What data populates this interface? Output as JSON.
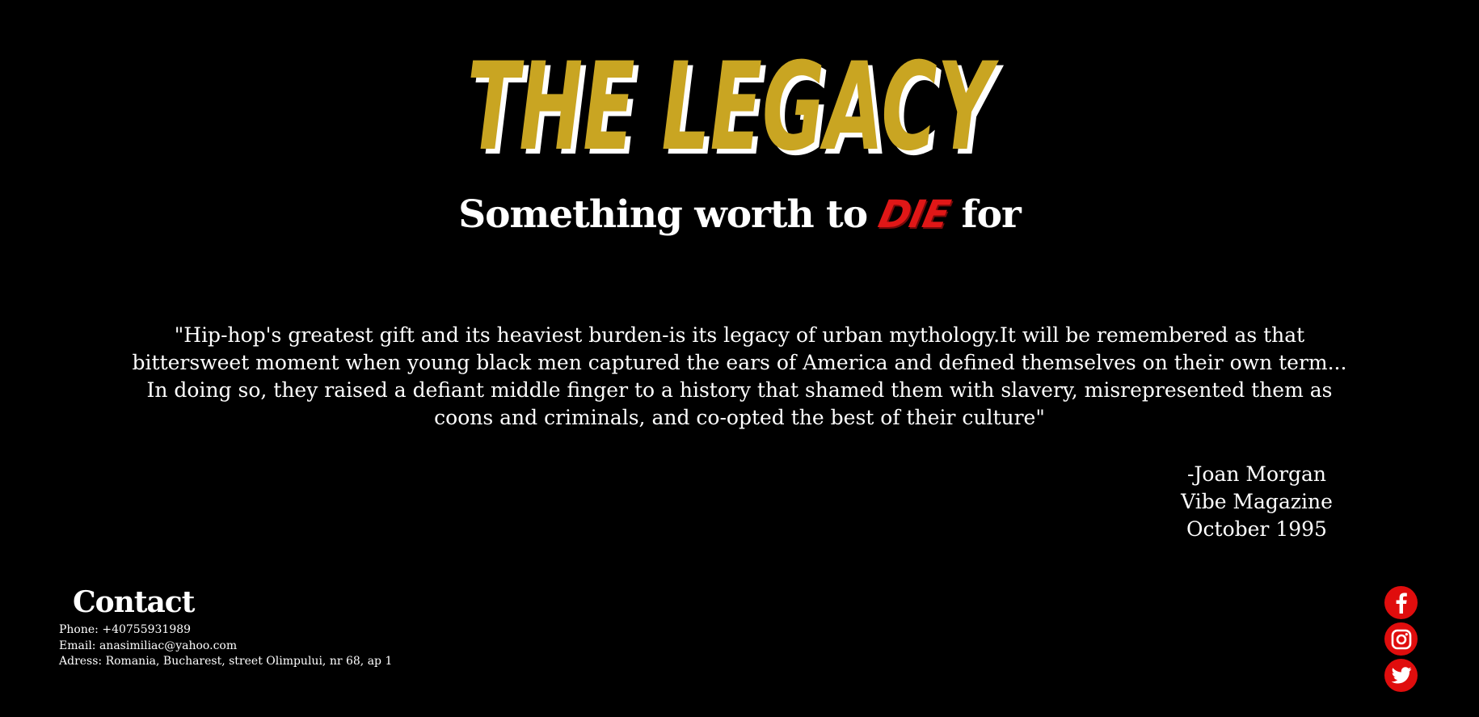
{
  "header": {
    "logo_text": "THE LEGACY",
    "tagline_before": "Something worth to ",
    "tagline_highlight": "DIE",
    "tagline_after": " for"
  },
  "quote": {
    "text": "\"Hip-hop's greatest gift and its heaviest burden-is its legacy of urban mythology.It will be remembered as that bittersweet moment when young black men captured the ears of America and defined themselves on their own term... In doing so, they raised a defiant middle finger to a history that shamed them with slavery, misrepresented them as coons and criminals, and co-opted the best of their culture\"",
    "author": "-Joan Morgan",
    "source": "Vibe Magazine",
    "date": "October 1995"
  },
  "contact": {
    "title": "Contact",
    "phone": "Phone: +40755931989",
    "email": "Email: anasimiliac@yahoo.com",
    "address": "Adress: Romania, Bucharest, street Olimpului, nr 68, ap 1"
  },
  "social": {
    "items": [
      {
        "name": "facebook",
        "icon": "facebook-icon"
      },
      {
        "name": "instagram",
        "icon": "instagram-icon"
      },
      {
        "name": "twitter",
        "icon": "twitter-icon"
      }
    ]
  },
  "colors": {
    "background": "#000000",
    "gold": "#c9a522",
    "red": "#e00d0d",
    "text": "#ffffff"
  }
}
